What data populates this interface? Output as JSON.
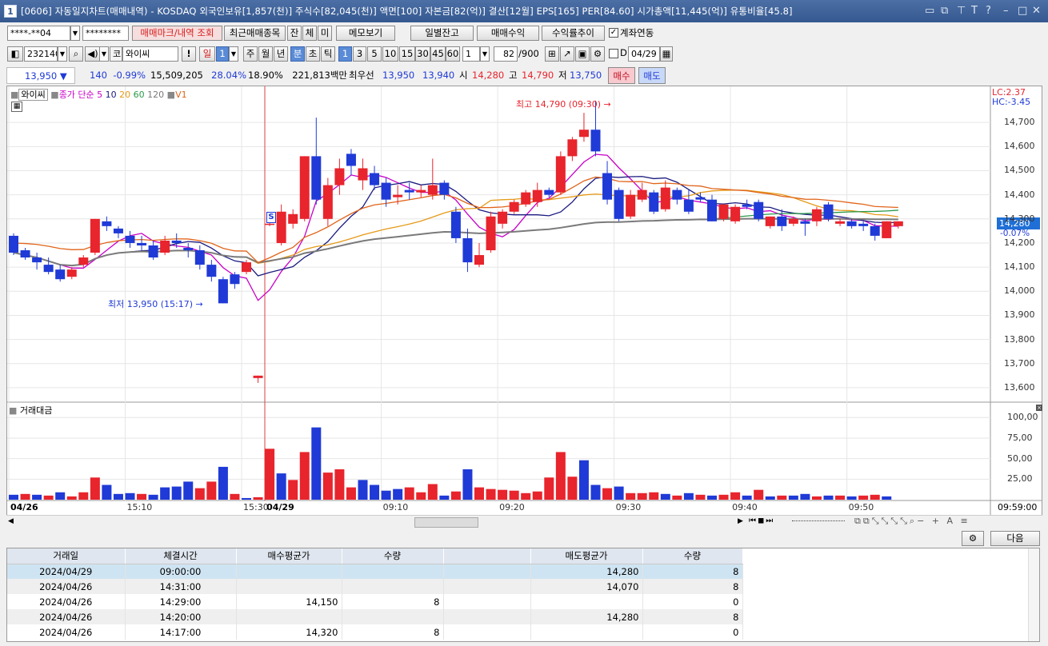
{
  "window": {
    "title": "[0606] 자동일지차트(매매내역) - KOSDAQ 외국인보유[1,857(천)] 주식수[82,045(천)] 액면[100] 자본금[82(억)] 결산[12월] EPS[165] PER[84.60] 시가총액[11,445(억)] 유통비율[45.8]",
    "icon_label": "1"
  },
  "toolbar1": {
    "account": "****-**04",
    "password": "********",
    "btn_mark": "매매마크/내역 조회",
    "btn_recent": "최근매매종목",
    "btn_jan": "잔",
    "btn_che": "체",
    "btn_mi": "미",
    "btn_memo": "메모보기",
    "btn_daily": "일별잔고",
    "btn_profit": "매매수익",
    "btn_trend": "수익률추이",
    "chk_link": "계좌연동"
  },
  "toolbar2": {
    "code": "232140",
    "market": "코",
    "name": "와이씨",
    "period_day": "일",
    "period_num": "1",
    "week": "주",
    "month": "월",
    "year": "년",
    "minute": "분",
    "second": "초",
    "tick": "틱",
    "intervals": [
      "1",
      "3",
      "5",
      "10",
      "15",
      "30",
      "45",
      "60"
    ],
    "count_sel": "1",
    "count": "82",
    "count_total": "/900",
    "chk_d": "D",
    "date": "04/29"
  },
  "pricebar": {
    "price": "13,950",
    "change": "140",
    "change_pct": "-0.99%",
    "volume": "15,509,205",
    "vol_ratio": "28.04%",
    "turnover": "18.90%",
    "amount": "221,813백만",
    "best_label": "최우선",
    "ask": "13,950",
    "bid": "13,940",
    "open_label": "시",
    "open": "14,280",
    "high_label": "고",
    "high": "14,790",
    "low_label": "저",
    "low": "13,750",
    "buy": "매수",
    "sell": "매도"
  },
  "chart": {
    "legend_name": "와이씨",
    "legend_close": "종가 단순",
    "legend_ma": [
      "5",
      "10",
      "20",
      "60",
      "120"
    ],
    "legend_v": "V1",
    "lc": "LC:2.37",
    "hc": "HC:-3.45",
    "price_ticks": [
      "14,700",
      "14,600",
      "14,500",
      "14,400",
      "14,300",
      "14,200",
      "14,100",
      "14,000",
      "13,900",
      "13,800",
      "13,700",
      "13,600"
    ],
    "current_price": "14,280",
    "current_pct": "-0.07%",
    "high_annot": "최고 14,790 (09:30)",
    "low_annot": "최저 13,950 (15:17)",
    "signal": "S",
    "vol_title": "거래대금",
    "vol_ticks": [
      "100,00",
      "75,00",
      "50,00",
      "25,00"
    ],
    "time_labels": [
      "04/26",
      "15:10",
      "15:30",
      "04/29",
      "09:10",
      "09:20",
      "09:30",
      "09:40",
      "09:50"
    ],
    "time_right": "09:59:00"
  },
  "chart_data": {
    "type": "candlestick",
    "ylim": [
      13550,
      14810
    ],
    "candles": [
      [
        14230,
        14160,
        14240,
        14150,
        1
      ],
      [
        14170,
        14140,
        14180,
        14130,
        1
      ],
      [
        14140,
        14120,
        14160,
        14090,
        1
      ],
      [
        14110,
        14080,
        14140,
        14070,
        1
      ],
      [
        14090,
        14050,
        14110,
        14040,
        1
      ],
      [
        14060,
        14090,
        14100,
        14050,
        0
      ],
      [
        14110,
        14140,
        14150,
        14100,
        0
      ],
      [
        14160,
        14300,
        14300,
        14150,
        0
      ],
      [
        14290,
        14270,
        14310,
        14250,
        1
      ],
      [
        14260,
        14240,
        14270,
        14220,
        1
      ],
      [
        14230,
        14200,
        14250,
        14180,
        1
      ],
      [
        14200,
        14190,
        14230,
        14170,
        1
      ],
      [
        14190,
        14140,
        14210,
        14130,
        1
      ],
      [
        14160,
        14210,
        14230,
        14150,
        0
      ],
      [
        14210,
        14200,
        14240,
        14180,
        1
      ],
      [
        14180,
        14170,
        14200,
        14140,
        1
      ],
      [
        14170,
        14110,
        14190,
        14090,
        1
      ],
      [
        14110,
        14060,
        14130,
        14040,
        1
      ],
      [
        14050,
        13950,
        14060,
        13950,
        1
      ],
      [
        14070,
        14030,
        14080,
        14010,
        1
      ],
      [
        14080,
        14120,
        14130,
        14070,
        0
      ],
      [
        13640,
        13650,
        13650,
        13620,
        0
      ],
      [
        14280,
        14280,
        14290,
        14270,
        0
      ],
      [
        14200,
        14330,
        14360,
        14190,
        0
      ],
      [
        14280,
        14320,
        14340,
        14260,
        0
      ],
      [
        14300,
        14560,
        14560,
        14290,
        0
      ],
      [
        14560,
        14380,
        14720,
        14360,
        1
      ],
      [
        14300,
        14440,
        14470,
        14270,
        0
      ],
      [
        14440,
        14510,
        14550,
        14400,
        0
      ],
      [
        14570,
        14520,
        14590,
        14480,
        1
      ],
      [
        14460,
        14510,
        14550,
        14420,
        0
      ],
      [
        14490,
        14440,
        14520,
        14420,
        1
      ],
      [
        14450,
        14380,
        14470,
        14350,
        1
      ],
      [
        14390,
        14400,
        14440,
        14360,
        0
      ],
      [
        14420,
        14410,
        14450,
        14380,
        1
      ],
      [
        14410,
        14420,
        14440,
        14390,
        0
      ],
      [
        14400,
        14440,
        14550,
        14380,
        0
      ],
      [
        14450,
        14400,
        14460,
        14380,
        1
      ],
      [
        14330,
        14220,
        14350,
        14200,
        1
      ],
      [
        14220,
        14120,
        14260,
        14080,
        1
      ],
      [
        14110,
        14150,
        14200,
        14100,
        0
      ],
      [
        14170,
        14310,
        14330,
        14160,
        0
      ],
      [
        14280,
        14330,
        14340,
        14260,
        0
      ],
      [
        14330,
        14370,
        14380,
        14320,
        0
      ],
      [
        14360,
        14410,
        14420,
        14350,
        0
      ],
      [
        14370,
        14420,
        14450,
        14350,
        0
      ],
      [
        14420,
        14400,
        14430,
        14390,
        1
      ],
      [
        14410,
        14560,
        14580,
        14400,
        0
      ],
      [
        14560,
        14630,
        14640,
        14540,
        0
      ],
      [
        14640,
        14670,
        14740,
        14620,
        0
      ],
      [
        14670,
        14580,
        14790,
        14560,
        1
      ],
      [
        14490,
        14380,
        14540,
        14360,
        1
      ],
      [
        14420,
        14300,
        14430,
        14290,
        1
      ],
      [
        14310,
        14400,
        14420,
        14300,
        0
      ],
      [
        14380,
        14420,
        14450,
        14370,
        0
      ],
      [
        14410,
        14330,
        14420,
        14320,
        1
      ],
      [
        14340,
        14430,
        14460,
        14330,
        0
      ],
      [
        14420,
        14380,
        14430,
        14360,
        1
      ],
      [
        14380,
        14330,
        14420,
        14320,
        1
      ],
      [
        14390,
        14380,
        14410,
        14370,
        1
      ],
      [
        14380,
        14290,
        14400,
        14290,
        1
      ],
      [
        14300,
        14360,
        14360,
        14290,
        0
      ],
      [
        14290,
        14350,
        14360,
        14280,
        0
      ],
      [
        14360,
        14350,
        14380,
        14340,
        1
      ],
      [
        14370,
        14300,
        14380,
        14290,
        1
      ],
      [
        14270,
        14310,
        14310,
        14260,
        0
      ],
      [
        14310,
        14270,
        14340,
        14250,
        1
      ],
      [
        14280,
        14300,
        14310,
        14270,
        0
      ],
      [
        14290,
        14280,
        14300,
        14230,
        1
      ],
      [
        14290,
        14340,
        14350,
        14270,
        0
      ],
      [
        14360,
        14300,
        14370,
        14290,
        1
      ],
      [
        14280,
        14290,
        14300,
        14270,
        0
      ],
      [
        14290,
        14270,
        14300,
        14260,
        1
      ],
      [
        14280,
        14270,
        14290,
        14250,
        1
      ],
      [
        14270,
        14230,
        14280,
        14210,
        1
      ],
      [
        14220,
        14290,
        14290,
        14220,
        0
      ],
      [
        14270,
        14290,
        14290,
        14260,
        0
      ]
    ],
    "volume_ticks": [
      100,
      75,
      50,
      25
    ],
    "volumes": [
      [
        6,
        1
      ],
      [
        7,
        0
      ],
      [
        6,
        1
      ],
      [
        5,
        0
      ],
      [
        9,
        1
      ],
      [
        4,
        0
      ],
      [
        9,
        0
      ],
      [
        27,
        0
      ],
      [
        18,
        1
      ],
      [
        7,
        1
      ],
      [
        8,
        1
      ],
      [
        7,
        0
      ],
      [
        6,
        1
      ],
      [
        15,
        1
      ],
      [
        16,
        1
      ],
      [
        22,
        1
      ],
      [
        14,
        0
      ],
      [
        22,
        0
      ],
      [
        40,
        1
      ],
      [
        7,
        0
      ],
      [
        2,
        1
      ],
      [
        3,
        0
      ],
      [
        62,
        0
      ],
      [
        32,
        1
      ],
      [
        24,
        0
      ],
      [
        58,
        0
      ],
      [
        88,
        1
      ],
      [
        33,
        0
      ],
      [
        37,
        0
      ],
      [
        15,
        0
      ],
      [
        24,
        1
      ],
      [
        18,
        1
      ],
      [
        11,
        1
      ],
      [
        13,
        1
      ],
      [
        15,
        0
      ],
      [
        9,
        0
      ],
      [
        19,
        0
      ],
      [
        5,
        1
      ],
      [
        10,
        0
      ],
      [
        37,
        1
      ],
      [
        15,
        0
      ],
      [
        13,
        0
      ],
      [
        12,
        0
      ],
      [
        11,
        0
      ],
      [
        8,
        0
      ],
      [
        10,
        0
      ],
      [
        27,
        0
      ],
      [
        58,
        0
      ],
      [
        28,
        0
      ],
      [
        48,
        1
      ],
      [
        18,
        1
      ],
      [
        14,
        0
      ],
      [
        16,
        1
      ],
      [
        8,
        0
      ],
      [
        8,
        0
      ],
      [
        9,
        0
      ],
      [
        7,
        1
      ],
      [
        5,
        0
      ],
      [
        8,
        1
      ],
      [
        6,
        0
      ],
      [
        5,
        1
      ],
      [
        6,
        0
      ],
      [
        9,
        0
      ],
      [
        5,
        1
      ],
      [
        12,
        0
      ],
      [
        4,
        1
      ],
      [
        5,
        0
      ],
      [
        5,
        1
      ],
      [
        7,
        1
      ],
      [
        4,
        0
      ],
      [
        5,
        1
      ],
      [
        5,
        0
      ],
      [
        4,
        1
      ],
      [
        5,
        0
      ],
      [
        6,
        0
      ],
      [
        4,
        1
      ]
    ],
    "ma_lines": [
      {
        "name": "5",
        "color": "#c800c8"
      },
      {
        "name": "10",
        "color": "#1a1a80"
      },
      {
        "name": "20",
        "color": "#e59a18"
      },
      {
        "name": "60",
        "color": "#2a9a48"
      },
      {
        "name": "120",
        "color": "#7a7a7a"
      },
      {
        "name": "V1",
        "color": "#e0641a"
      }
    ]
  },
  "trades": {
    "headers": [
      "거래일",
      "체결시간",
      "매수평균가",
      "수량",
      "",
      "매도평균가",
      "수량"
    ],
    "rows": [
      [
        "2024/04/29",
        "09:00:00",
        "",
        "",
        "",
        "14,280",
        "8"
      ],
      [
        "2024/04/26",
        "14:31:00",
        "",
        "",
        "",
        "14,070",
        "8"
      ],
      [
        "2024/04/26",
        "14:29:00",
        "14,150",
        "8",
        "",
        "",
        "0"
      ],
      [
        "2024/04/26",
        "14:20:00",
        "",
        "",
        "",
        "14,280",
        "8"
      ],
      [
        "2024/04/26",
        "14:17:00",
        "14,320",
        "8",
        "",
        "",
        "0"
      ]
    ],
    "next": "다음"
  },
  "colors": {
    "up": "#e8242c",
    "down": "#1f3ad6",
    "accent": "#34588f"
  }
}
